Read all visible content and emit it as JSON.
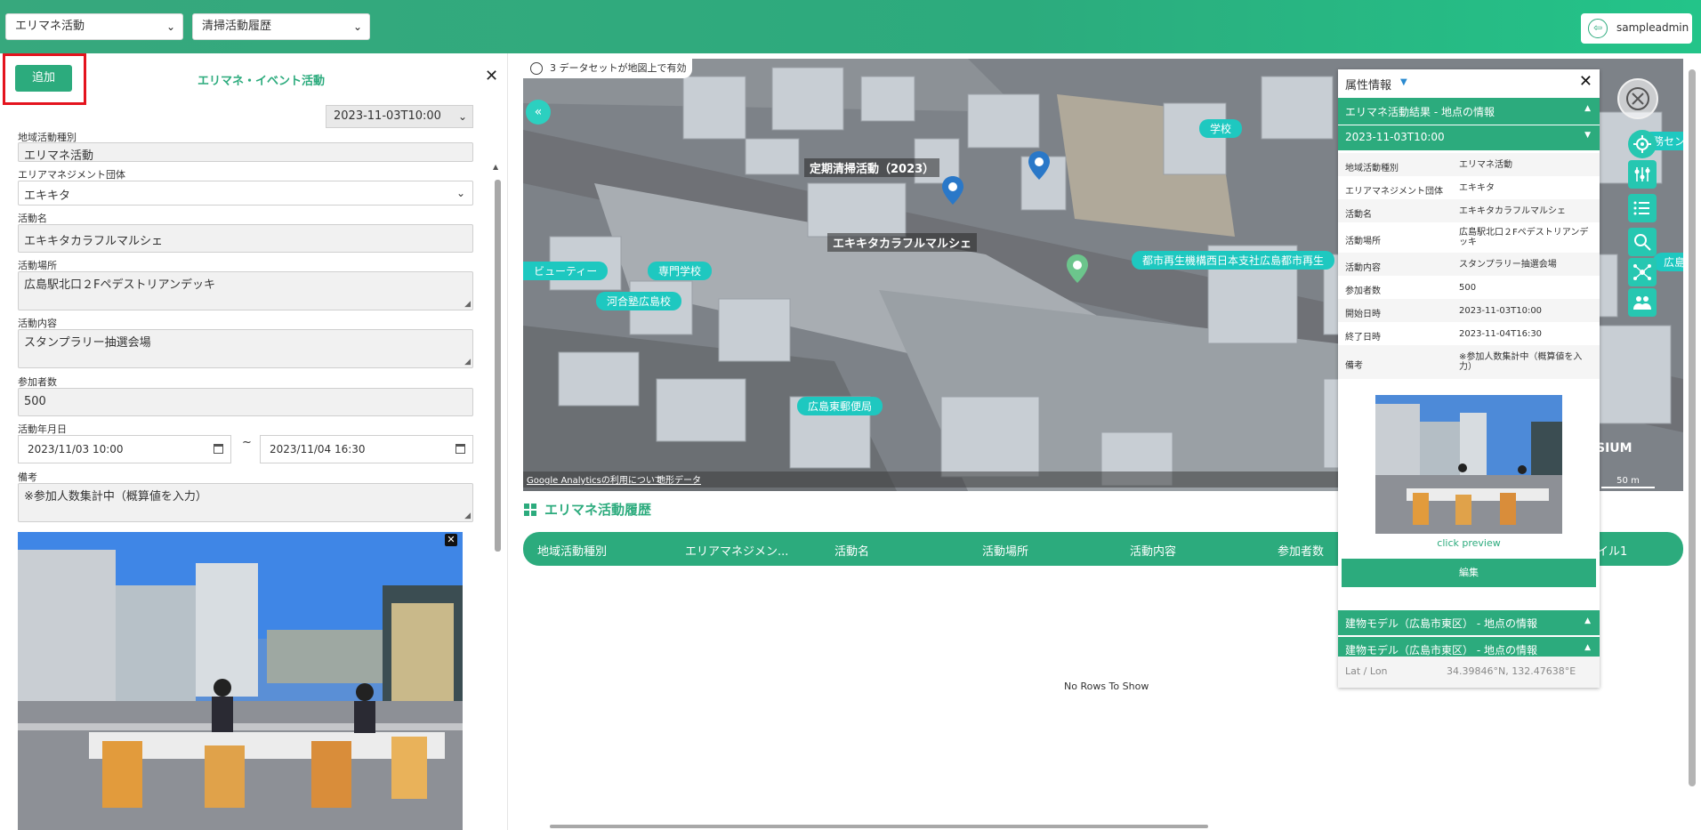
{
  "topbar": {
    "select1": "エリマネ活動",
    "select2": "清掃活動履歴",
    "user": "sampleadmin"
  },
  "panel": {
    "add_button": "追加",
    "title": "エリマネ・イベント活動",
    "close": "✕",
    "date_select": "2023-11-03T10:00",
    "fields": {
      "type_label": "地域活動種別",
      "type_value": "エリマネ活動",
      "org_label": "エリアマネジメント団体",
      "org_value": "エキキタ",
      "name_label": "活動名",
      "name_value": "エキキタカラフルマルシェ",
      "place_label": "活動場所",
      "place_value": "広島駅北口２Fペデストリアンデッキ",
      "content_label": "活動内容",
      "content_value": "スタンプラリー抽選会場",
      "count_label": "参加者数",
      "count_value": "500",
      "date_label": "活動年月日",
      "date_start": "2023/11/03 10:00",
      "date_sep": "~",
      "date_end": "2023/11/04 16:30",
      "note_label": "備考",
      "note_value": "※参加人数集計中（概算値を入力）"
    }
  },
  "map": {
    "dataset_badge": "3 データセットが地図上で有効",
    "labels": [
      {
        "text": "定期清掃活動（2023）"
      },
      {
        "text": "エキキタカラフルマルシェ"
      },
      {
        "text": "都市再生機構西日本支社広島都市再生"
      },
      {
        "text": "専門学校"
      },
      {
        "text": "ビューティー"
      },
      {
        "text": "河合塾広島校"
      },
      {
        "text": "広島東郵便局"
      },
      {
        "text": "学校"
      },
      {
        "text": "務セン"
      },
      {
        "text": "広島"
      }
    ],
    "credit_analytics": "Google Analyticsの利用について",
    "credit_terrain": "地形データ",
    "scale": "50 m",
    "cesium": "SIUM"
  },
  "history": {
    "title": "エリマネ活動履歴",
    "columns": [
      "地域活動種別",
      "エリアマネジメン...",
      "活動名",
      "活動場所",
      "活動内容",
      "参加者数",
      "イル1"
    ],
    "empty": "No Rows To Show"
  },
  "props": {
    "title": "属性情報",
    "section1": "エリマネ活動結果 - 地点の情報",
    "date": "2023-11-03T10:00",
    "rows": [
      {
        "k": "地域活動種別",
        "v": "エリマネ活動"
      },
      {
        "k": "エリアマネジメント団体",
        "v": "エキキタ"
      },
      {
        "k": "活動名",
        "v": "エキキタカラフルマルシェ"
      },
      {
        "k": "活動場所",
        "v": "広島駅北口２Fペデストリアンデッキ"
      },
      {
        "k": "活動内容",
        "v": "スタンプラリー抽選会場"
      },
      {
        "k": "参加者数",
        "v": "500"
      },
      {
        "k": "開始日時",
        "v": "2023-11-03T10:00"
      },
      {
        "k": "終了日時",
        "v": "2023-11-04T16:30"
      },
      {
        "k": "備考",
        "v": "※参加人数集計中（概算値を入力）"
      }
    ],
    "click_preview": "click preview",
    "edit": "編集",
    "section2": "建物モデル（広島市東区） - 地点の情報",
    "section3": "建物モデル（広島市東区） - 地点の情報",
    "latlon_label": "Lat / Lon",
    "latlon_value": "34.39846°N, 132.47638°E"
  }
}
